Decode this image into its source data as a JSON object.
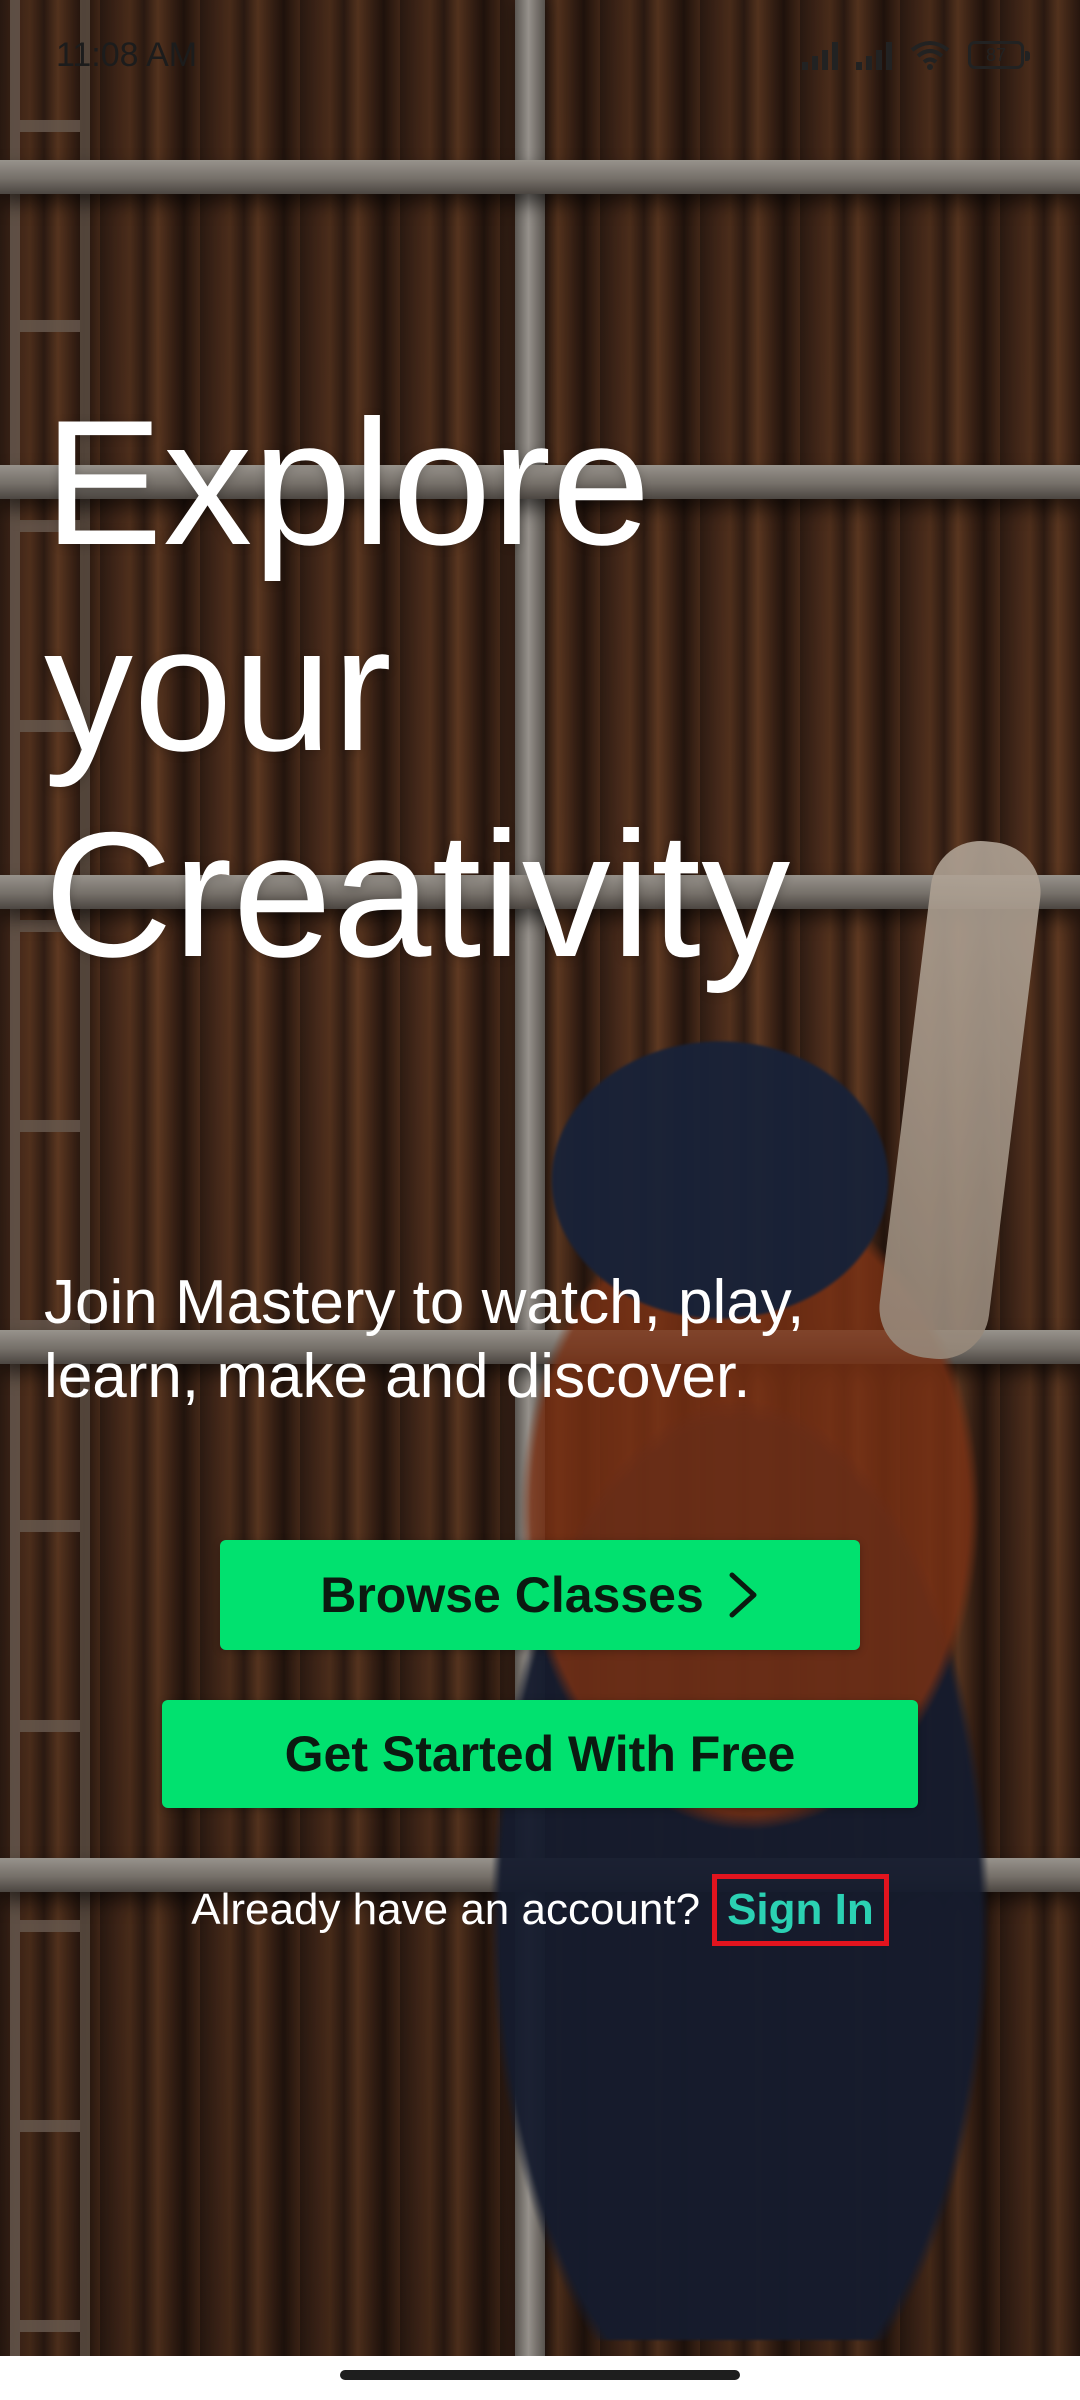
{
  "status_bar": {
    "time": "11:08 AM",
    "battery_level": "87",
    "icons": [
      "signal-icon",
      "signal-icon",
      "wifi-icon",
      "battery-icon"
    ]
  },
  "hero": {
    "title_lines": [
      "Explore",
      "your",
      "Creativity"
    ],
    "subtitle_lines": [
      "Join Mastery to watch, play,",
      "learn, make and discover."
    ]
  },
  "actions": {
    "browse_label": "Browse Classes",
    "get_started_label": "Get Started With Free",
    "signin_prompt": "Already have an account?",
    "signin_label": "Sign In"
  },
  "colors": {
    "accent_green": "#01e16f",
    "signin_teal": "#2bd1b3",
    "highlight_red": "#e2141e"
  }
}
